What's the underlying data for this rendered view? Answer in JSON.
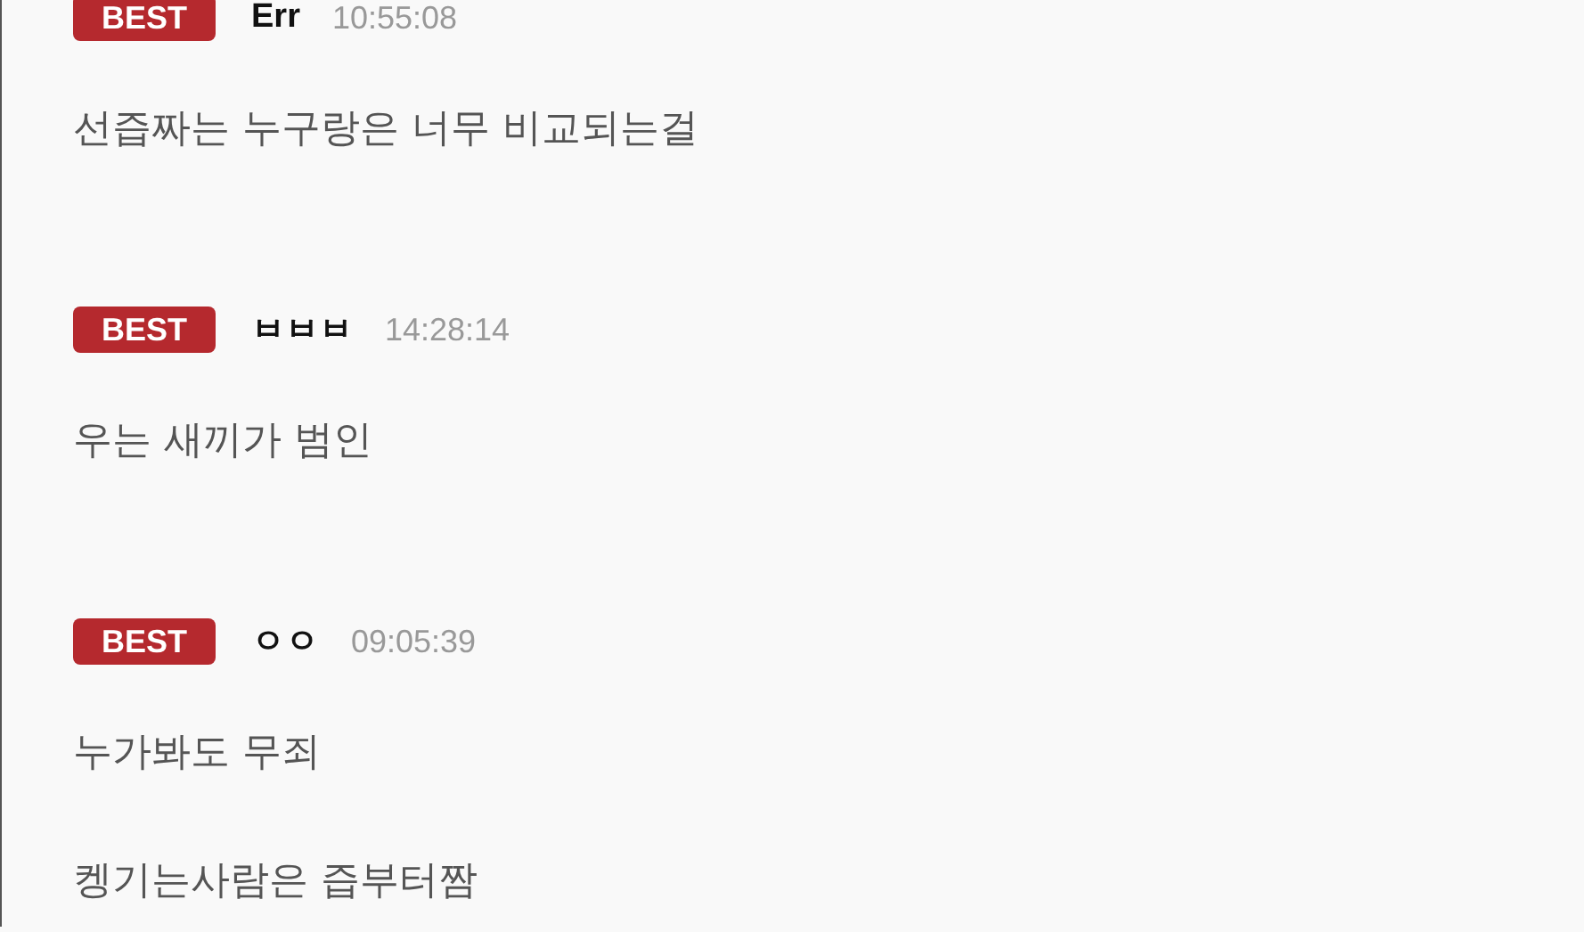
{
  "comments": [
    {
      "badge": "BEST",
      "author": "Err",
      "time": "10:55:08",
      "paragraphs": [
        "선즙짜는 누구랑은 너무 비교되는걸"
      ]
    },
    {
      "badge": "BEST",
      "author": "ㅂㅂㅂ",
      "time": "14:28:14",
      "paragraphs": [
        "우는 새끼가 범인"
      ]
    },
    {
      "badge": "BEST",
      "author": "ㅇㅇ",
      "time": "09:05:39",
      "paragraphs": [
        "누가봐도 무죄",
        "켕기는사람은 즙부터짬"
      ]
    }
  ]
}
